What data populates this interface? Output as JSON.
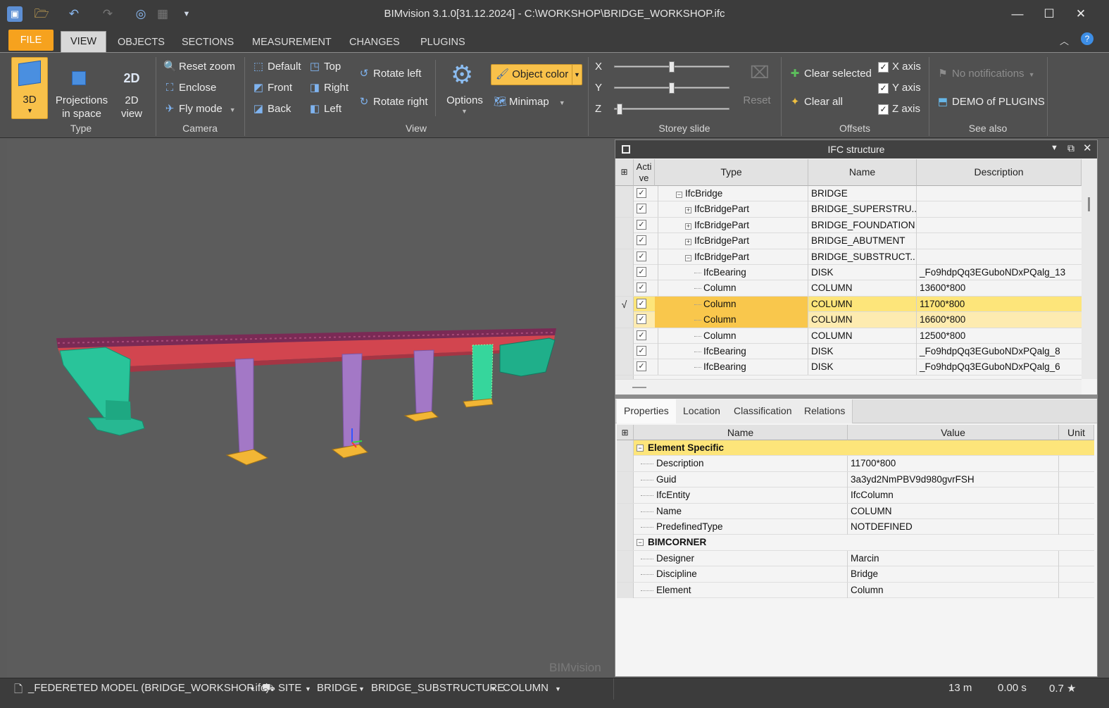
{
  "window": {
    "title": "BIMvision 3.1.0[31.12.2024] - C:\\WORKSHOP\\BRIDGE_WORKSHOP.ifc",
    "minimize": "—",
    "maximize": "☐",
    "close": "✕"
  },
  "tabs": {
    "file": "FILE",
    "view": "VIEW",
    "objects": "OBJECTS",
    "sections": "SECTIONS",
    "measurement": "MEASUREMENT",
    "changes": "CHANGES",
    "plugins": "PLUGINS"
  },
  "ribbon": {
    "type": {
      "label": "Type",
      "btn_3d": "3D",
      "projections": "Projections",
      "projections2": "in space",
      "view2d": "2D",
      "view2d2": "view",
      "view2d_icon": "2D"
    },
    "camera": {
      "label": "Camera",
      "reset_zoom": "Reset zoom",
      "enclose": "Enclose",
      "fly_mode": "Fly mode"
    },
    "view": {
      "label": "View",
      "default": "Default",
      "front": "Front",
      "back": "Back",
      "top": "Top",
      "right": "Right",
      "left": "Left",
      "rotate_left": "Rotate left",
      "rotate_right": "Rotate right",
      "options": "Options",
      "object_color": "Object color",
      "minimap": "Minimap"
    },
    "storey": {
      "label": "Storey slide",
      "x": "X",
      "y": "Y",
      "z": "Z",
      "x_pos": 0.5,
      "y_pos": 0.5,
      "z_pos": 0.02,
      "reset": "Reset"
    },
    "offsets": {
      "label": "Offsets",
      "clear_selected": "Clear selected",
      "clear_all": "Clear all",
      "x_axis": "X axis",
      "y_axis": "Y axis",
      "z_axis": "Z axis"
    },
    "see_also": {
      "label": "See also",
      "no_notifications": "No notifications",
      "demo": "DEMO of PLUGINS"
    }
  },
  "viewport": {
    "watermark": "BIMvision"
  },
  "ifc": {
    "title": "IFC structure",
    "headers": {
      "active": "Acti ve",
      "type": "Type",
      "name": "Name",
      "description": "Description"
    },
    "rows": [
      {
        "type": "IfcBridge",
        "name": "BRIDGE",
        "desc": "",
        "indent": 0,
        "toggle": "−"
      },
      {
        "type": "IfcBridgePart",
        "name": "BRIDGE_SUPERSTRU...",
        "desc": "",
        "indent": 1,
        "toggle": "+"
      },
      {
        "type": "IfcBridgePart",
        "name": "BRIDGE_FOUNDATION",
        "desc": "",
        "indent": 1,
        "toggle": "+"
      },
      {
        "type": "IfcBridgePart",
        "name": "BRIDGE_ABUTMENT",
        "desc": "",
        "indent": 1,
        "toggle": "+"
      },
      {
        "type": "IfcBridgePart",
        "name": "BRIDGE_SUBSTRUCT...",
        "desc": "",
        "indent": 1,
        "toggle": "−"
      },
      {
        "type": "IfcBearing",
        "name": "DISK",
        "desc": "_Fo9hdpQq3EGuboNDxPQalg_13",
        "indent": 2,
        "toggle": ""
      },
      {
        "type": "Column",
        "name": "COLUMN",
        "desc": "13600*800",
        "indent": 2,
        "toggle": ""
      },
      {
        "type": "Column",
        "name": "COLUMN",
        "desc": "11700*800",
        "indent": 2,
        "toggle": "",
        "state": "hl",
        "mark": "√"
      },
      {
        "type": "Column",
        "name": "COLUMN",
        "desc": "16600*800",
        "indent": 2,
        "toggle": "",
        "state": "hl2"
      },
      {
        "type": "Column",
        "name": "COLUMN",
        "desc": "12500*800",
        "indent": 2,
        "toggle": ""
      },
      {
        "type": "IfcBearing",
        "name": "DISK",
        "desc": "_Fo9hdpQq3EGuboNDxPQalg_8",
        "indent": 2,
        "toggle": ""
      },
      {
        "type": "IfcBearing",
        "name": "DISK",
        "desc": "_Fo9hdpQq3EGuboNDxPQalg_6",
        "indent": 2,
        "toggle": ""
      }
    ]
  },
  "props": {
    "tabs": {
      "properties": "Properties",
      "location": "Location",
      "classification": "Classification",
      "relations": "Relations"
    },
    "headers": {
      "name": "Name",
      "value": "Value",
      "unit": "Unit"
    },
    "group1": "Element Specific",
    "group1_rows": [
      {
        "name": "Description",
        "value": "11700*800"
      },
      {
        "name": "Guid",
        "value": "3a3yd2NmPBV9d980gvrFSH"
      },
      {
        "name": "IfcEntity",
        "value": "IfcColumn"
      },
      {
        "name": "Name",
        "value": "COLUMN"
      },
      {
        "name": "PredefinedType",
        "value": "NOTDEFINED"
      }
    ],
    "group2": "BIMCORNER",
    "group2_rows": [
      {
        "name": "Designer",
        "value": "Marcin"
      },
      {
        "name": "Discipline",
        "value": "Bridge"
      },
      {
        "name": "Element",
        "value": "Column"
      }
    ]
  },
  "status": {
    "model": "_FEDERETED MODEL (BRIDGE_WORKSHOP.ifc)",
    "site": "SITE",
    "bridge": "BRIDGE",
    "substructure": "BRIDGE_SUBSTRUCTURE",
    "column": "COLUMN",
    "distance": "13 m",
    "time": "0.00 s",
    "speed": "0.7 ★"
  }
}
